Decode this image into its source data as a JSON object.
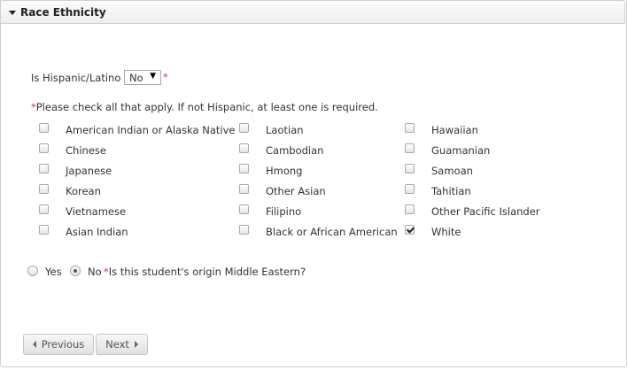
{
  "section": {
    "title": "Race Ethnicity",
    "icon": "caret-down-icon"
  },
  "hispanic": {
    "label": "Is Hispanic/Latino",
    "selected": "No",
    "required_mark": "*"
  },
  "instruction": {
    "required_mark": "*",
    "text": "Please check all that apply. If not Hispanic, at least one is required."
  },
  "races": {
    "col1": [
      {
        "label": "American Indian or Alaska Native",
        "checked": false
      },
      {
        "label": "Chinese",
        "checked": false
      },
      {
        "label": "Japanese",
        "checked": false
      },
      {
        "label": "Korean",
        "checked": false
      },
      {
        "label": "Vietnamese",
        "checked": false
      },
      {
        "label": "Asian Indian",
        "checked": false
      }
    ],
    "col2": [
      {
        "label": "Laotian",
        "checked": false
      },
      {
        "label": "Cambodian",
        "checked": false
      },
      {
        "label": "Hmong",
        "checked": false
      },
      {
        "label": "Other Asian",
        "checked": false
      },
      {
        "label": "Filipino",
        "checked": false
      },
      {
        "label": "Black or African American",
        "checked": false
      }
    ],
    "col3": [
      {
        "label": "Hawaiian",
        "checked": false
      },
      {
        "label": "Guamanian",
        "checked": false
      },
      {
        "label": "Samoan",
        "checked": false
      },
      {
        "label": "Tahitian",
        "checked": false
      },
      {
        "label": "Other Pacific Islander",
        "checked": false
      },
      {
        "label": "White",
        "checked": true
      }
    ]
  },
  "middle_eastern": {
    "yes_label": "Yes",
    "no_label": "No",
    "selected": "No",
    "required_mark": "*",
    "question": "Is this student's origin Middle Eastern?"
  },
  "nav": {
    "previous_label": "Previous",
    "next_label": "Next"
  },
  "colors": {
    "required": "#e03030",
    "border": "#cfcfcf"
  }
}
